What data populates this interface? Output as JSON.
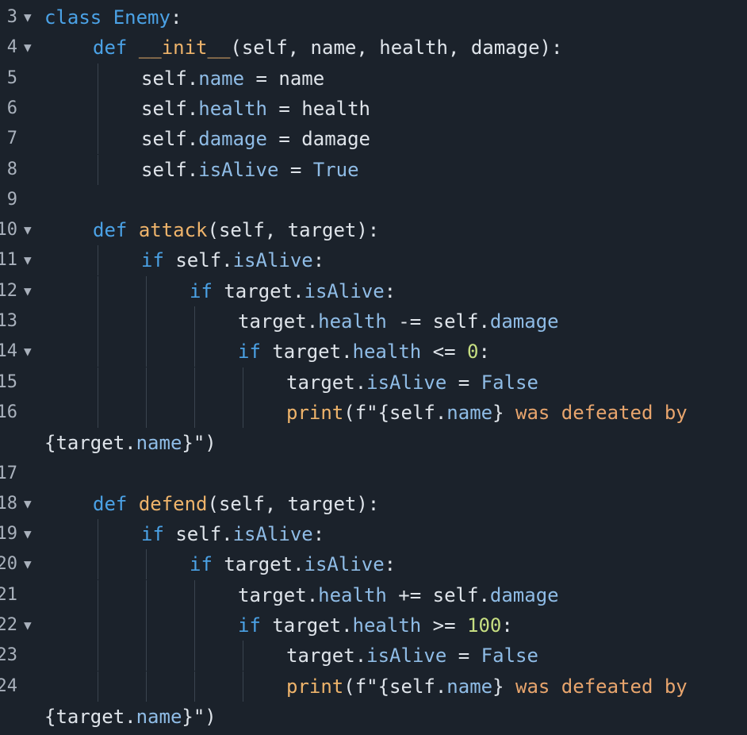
{
  "editor": {
    "lines": [
      {
        "number": "3",
        "foldable": true,
        "indent": 0,
        "tokens": [
          {
            "t": "class",
            "c": "kw"
          },
          {
            "t": " "
          },
          {
            "t": "Enemy",
            "c": "cls"
          },
          {
            "t": ":"
          }
        ]
      },
      {
        "number": "4",
        "foldable": true,
        "indent": 1,
        "tokens": [
          {
            "t": "def",
            "c": "kw"
          },
          {
            "t": " "
          },
          {
            "t": "__init__",
            "c": "dunder"
          },
          {
            "t": "(self, name, health, damage):"
          }
        ]
      },
      {
        "number": "5",
        "foldable": false,
        "indent": 2,
        "tokens": [
          {
            "t": "self"
          },
          {
            "t": "."
          },
          {
            "t": "name",
            "c": "attr"
          },
          {
            "t": " = name"
          }
        ]
      },
      {
        "number": "6",
        "foldable": false,
        "indent": 2,
        "tokens": [
          {
            "t": "self"
          },
          {
            "t": "."
          },
          {
            "t": "health",
            "c": "attr"
          },
          {
            "t": " = health"
          }
        ]
      },
      {
        "number": "7",
        "foldable": false,
        "indent": 2,
        "tokens": [
          {
            "t": "self"
          },
          {
            "t": "."
          },
          {
            "t": "damage",
            "c": "attr"
          },
          {
            "t": " = damage"
          }
        ]
      },
      {
        "number": "8",
        "foldable": false,
        "indent": 2,
        "tokens": [
          {
            "t": "self"
          },
          {
            "t": "."
          },
          {
            "t": "isAlive",
            "c": "attr"
          },
          {
            "t": " = "
          },
          {
            "t": "True",
            "c": "attr"
          }
        ]
      },
      {
        "number": "9",
        "foldable": false,
        "indent": 0,
        "tokens": []
      },
      {
        "number": "10",
        "foldable": true,
        "indent": 1,
        "tokens": [
          {
            "t": "def",
            "c": "kw"
          },
          {
            "t": " "
          },
          {
            "t": "attack",
            "c": "fn"
          },
          {
            "t": "(self, target):"
          }
        ]
      },
      {
        "number": "11",
        "foldable": true,
        "indent": 2,
        "tokens": [
          {
            "t": "if",
            "c": "kw"
          },
          {
            "t": " self"
          },
          {
            "t": "."
          },
          {
            "t": "isAlive",
            "c": "attr"
          },
          {
            "t": ":"
          }
        ]
      },
      {
        "number": "12",
        "foldable": true,
        "indent": 3,
        "tokens": [
          {
            "t": "if",
            "c": "kw"
          },
          {
            "t": " target"
          },
          {
            "t": "."
          },
          {
            "t": "isAlive",
            "c": "attr"
          },
          {
            "t": ":"
          }
        ]
      },
      {
        "number": "13",
        "foldable": false,
        "indent": 4,
        "tokens": [
          {
            "t": "target"
          },
          {
            "t": "."
          },
          {
            "t": "health",
            "c": "attr"
          },
          {
            "t": " -= self"
          },
          {
            "t": "."
          },
          {
            "t": "damage",
            "c": "attr"
          }
        ]
      },
      {
        "number": "14",
        "foldable": true,
        "indent": 4,
        "tokens": [
          {
            "t": "if",
            "c": "kw"
          },
          {
            "t": " target"
          },
          {
            "t": "."
          },
          {
            "t": "health",
            "c": "attr"
          },
          {
            "t": " <= "
          },
          {
            "t": "0",
            "c": "num"
          },
          {
            "t": ":"
          }
        ]
      },
      {
        "number": "15",
        "foldable": false,
        "indent": 5,
        "tokens": [
          {
            "t": "target"
          },
          {
            "t": "."
          },
          {
            "t": "isAlive",
            "c": "attr"
          },
          {
            "t": " = "
          },
          {
            "t": "False",
            "c": "attr"
          }
        ]
      },
      {
        "number": "16",
        "foldable": false,
        "indent": 5,
        "tokens": [
          {
            "t": "print",
            "c": "fn"
          },
          {
            "t": "(f\"{self"
          },
          {
            "t": "."
          },
          {
            "t": "name",
            "c": "attr"
          },
          {
            "t": "}"
          },
          {
            "t": " was defeated by",
            "c": "str"
          }
        ]
      },
      {
        "number": "",
        "foldable": false,
        "indent": 0,
        "tokens": [
          {
            "t": "{target"
          },
          {
            "t": "."
          },
          {
            "t": "name",
            "c": "attr"
          },
          {
            "t": "}\")"
          }
        ]
      },
      {
        "number": "17",
        "foldable": false,
        "indent": 0,
        "tokens": []
      },
      {
        "number": "18",
        "foldable": true,
        "indent": 1,
        "tokens": [
          {
            "t": "def",
            "c": "kw"
          },
          {
            "t": " "
          },
          {
            "t": "defend",
            "c": "fn"
          },
          {
            "t": "(self, target):"
          }
        ]
      },
      {
        "number": "19",
        "foldable": true,
        "indent": 2,
        "tokens": [
          {
            "t": "if",
            "c": "kw"
          },
          {
            "t": " self"
          },
          {
            "t": "."
          },
          {
            "t": "isAlive",
            "c": "attr"
          },
          {
            "t": ":"
          }
        ]
      },
      {
        "number": "20",
        "foldable": true,
        "indent": 3,
        "tokens": [
          {
            "t": "if",
            "c": "kw"
          },
          {
            "t": " target"
          },
          {
            "t": "."
          },
          {
            "t": "isAlive",
            "c": "attr"
          },
          {
            "t": ":"
          }
        ]
      },
      {
        "number": "21",
        "foldable": false,
        "indent": 4,
        "tokens": [
          {
            "t": "target"
          },
          {
            "t": "."
          },
          {
            "t": "health",
            "c": "attr"
          },
          {
            "t": " += self"
          },
          {
            "t": "."
          },
          {
            "t": "damage",
            "c": "attr"
          }
        ]
      },
      {
        "number": "22",
        "foldable": true,
        "indent": 4,
        "tokens": [
          {
            "t": "if",
            "c": "kw"
          },
          {
            "t": " target"
          },
          {
            "t": "."
          },
          {
            "t": "health",
            "c": "attr"
          },
          {
            "t": " >= "
          },
          {
            "t": "100",
            "c": "num"
          },
          {
            "t": ":"
          }
        ]
      },
      {
        "number": "23",
        "foldable": false,
        "indent": 5,
        "tokens": [
          {
            "t": "target"
          },
          {
            "t": "."
          },
          {
            "t": "isAlive",
            "c": "attr"
          },
          {
            "t": " = "
          },
          {
            "t": "False",
            "c": "attr"
          }
        ]
      },
      {
        "number": "24",
        "foldable": false,
        "indent": 5,
        "tokens": [
          {
            "t": "print",
            "c": "fn"
          },
          {
            "t": "(f\"{self"
          },
          {
            "t": "."
          },
          {
            "t": "name",
            "c": "attr"
          },
          {
            "t": "}"
          },
          {
            "t": " was defeated by",
            "c": "str"
          }
        ]
      },
      {
        "number": "",
        "foldable": false,
        "indent": 0,
        "tokens": [
          {
            "t": "{target"
          },
          {
            "t": "."
          },
          {
            "t": "name",
            "c": "attr"
          },
          {
            "t": "}\")"
          }
        ]
      }
    ],
    "fold_glyph": "▼",
    "colors": {
      "background": "#1b222b",
      "text": "#dfe4ea",
      "keyword": "#4ba2e6",
      "function": "#efb46b",
      "attribute": "#8fbce6",
      "number": "#c7df82",
      "string": "#e8a56d",
      "line_number": "#a9b1bc"
    }
  }
}
